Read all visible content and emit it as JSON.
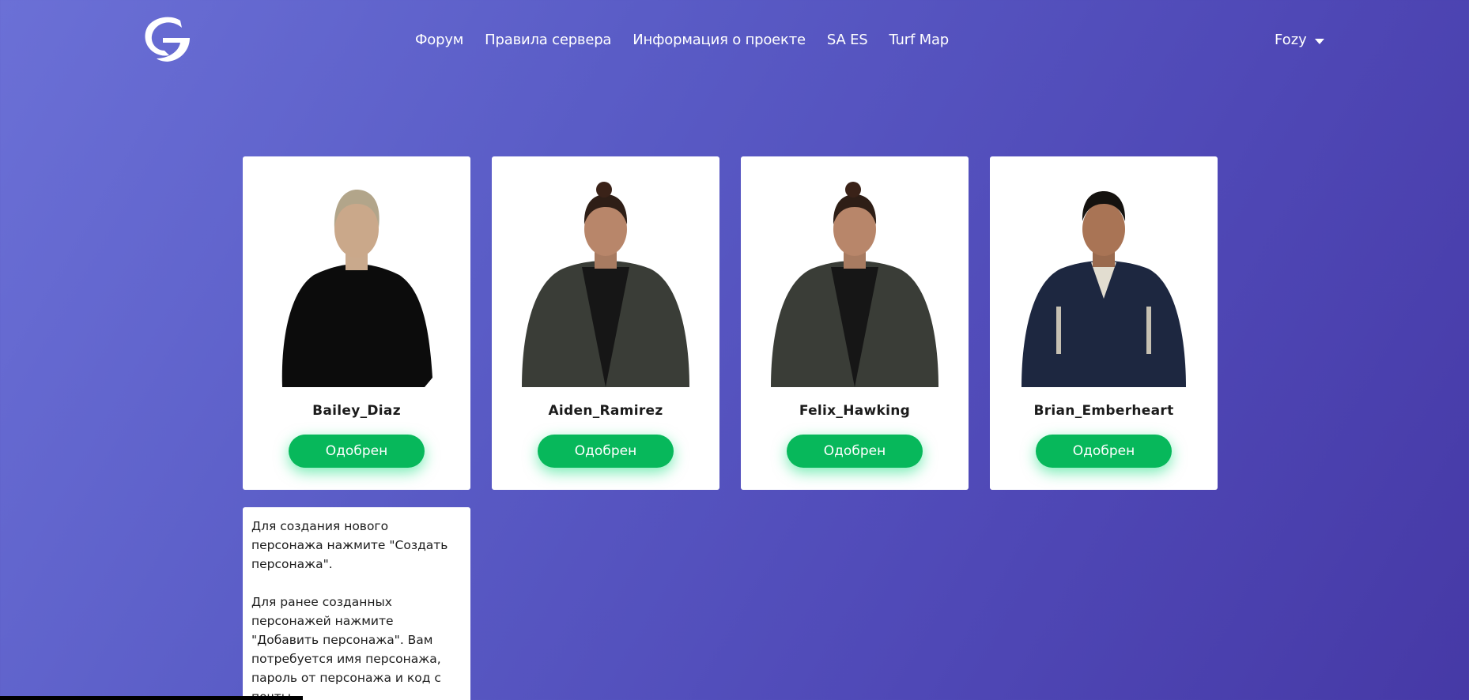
{
  "header": {
    "logo_icon": "g-logo-icon",
    "nav": [
      "Форум",
      "Правила сервера",
      "Информация о проекте",
      "SA ES",
      "Turf Map"
    ],
    "user": {
      "name": "Fozy",
      "caret_icon": "caret-down-icon"
    }
  },
  "characters": [
    {
      "name": "Bailey_Diaz",
      "status": "Одобрен"
    },
    {
      "name": "Aiden_Ramirez",
      "status": "Одобрен"
    },
    {
      "name": "Felix_Hawking",
      "status": "Одобрен"
    },
    {
      "name": "Brian_Emberheart",
      "status": "Одобрен"
    }
  ],
  "info": {
    "paragraph1": "Для создания нового персонажа нажмите \"Создать персонажа\".",
    "paragraph2": "Для ранее созданных персонажей нажмите \"Добавить персонажа\". Вам потребуется имя персонажа, пароль от персонажа и код с почты."
  },
  "colors": {
    "background_start": "#6b70d6",
    "background_end": "#4639a6",
    "status_green": "#07b85b"
  }
}
